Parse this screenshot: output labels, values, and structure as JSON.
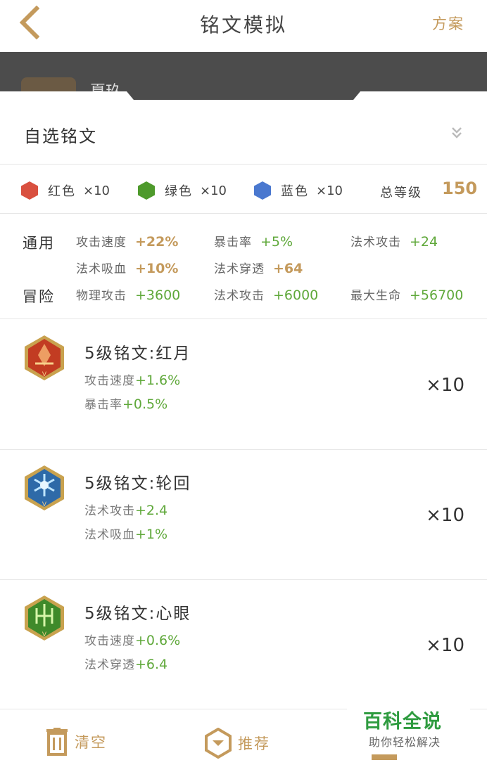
{
  "header": {
    "title": "铭文模拟",
    "plan_label": "方案"
  },
  "hero_peek": "夏玖",
  "picker": {
    "label": "自选铭文"
  },
  "colors": [
    {
      "name": "红色",
      "count": "×10",
      "color": "#d9503f"
    },
    {
      "name": "绿色",
      "count": "×10",
      "color": "#4e9a2c"
    },
    {
      "name": "蓝色",
      "count": "×10",
      "color": "#4a78cf"
    }
  ],
  "total": {
    "label": "总等级",
    "value": "150"
  },
  "stats": {
    "general_label": "通用",
    "general": [
      {
        "name": "攻击速度",
        "value": "+22%"
      },
      {
        "name": "暴击率",
        "value": "+5%"
      },
      {
        "name": "法术攻击",
        "value": "+24"
      },
      {
        "name": "法术吸血",
        "value": "+10%"
      },
      {
        "name": "法术穿透",
        "value": "+64"
      }
    ],
    "adventure_label": "冒险",
    "adventure": [
      {
        "name": "物理攻击",
        "value": "+3600"
      },
      {
        "name": "法术攻击",
        "value": "+6000"
      },
      {
        "name": "最大生命",
        "value": "+56700"
      }
    ]
  },
  "items": [
    {
      "name": "5级铭文:红月",
      "gem_icon": "red-moon-gem-icon",
      "stats": [
        {
          "name": "攻击速度",
          "value": "+1.6%"
        },
        {
          "name": "暴击率",
          "value": "+0.5%"
        }
      ],
      "qty": "×10"
    },
    {
      "name": "5级铭文:轮回",
      "gem_icon": "samsara-gem-icon",
      "stats": [
        {
          "name": "法术攻击",
          "value": "+2.4"
        },
        {
          "name": "法术吸血",
          "value": "+1%"
        }
      ],
      "qty": "×10"
    },
    {
      "name": "5级铭文:心眼",
      "gem_icon": "mind-eye-gem-icon",
      "stats": [
        {
          "name": "攻击速度",
          "value": "+0.6%"
        },
        {
          "name": "法术穿透",
          "value": "+6.4"
        }
      ],
      "qty": "×10"
    }
  ],
  "bottom": {
    "clear_label": "清空",
    "recommend_label": "推荐"
  },
  "watermark": {
    "title": "百科全说",
    "subtitle": "助你轻松解决"
  },
  "accent_color": "#c49a5c",
  "positive_color": "#5fa83a"
}
